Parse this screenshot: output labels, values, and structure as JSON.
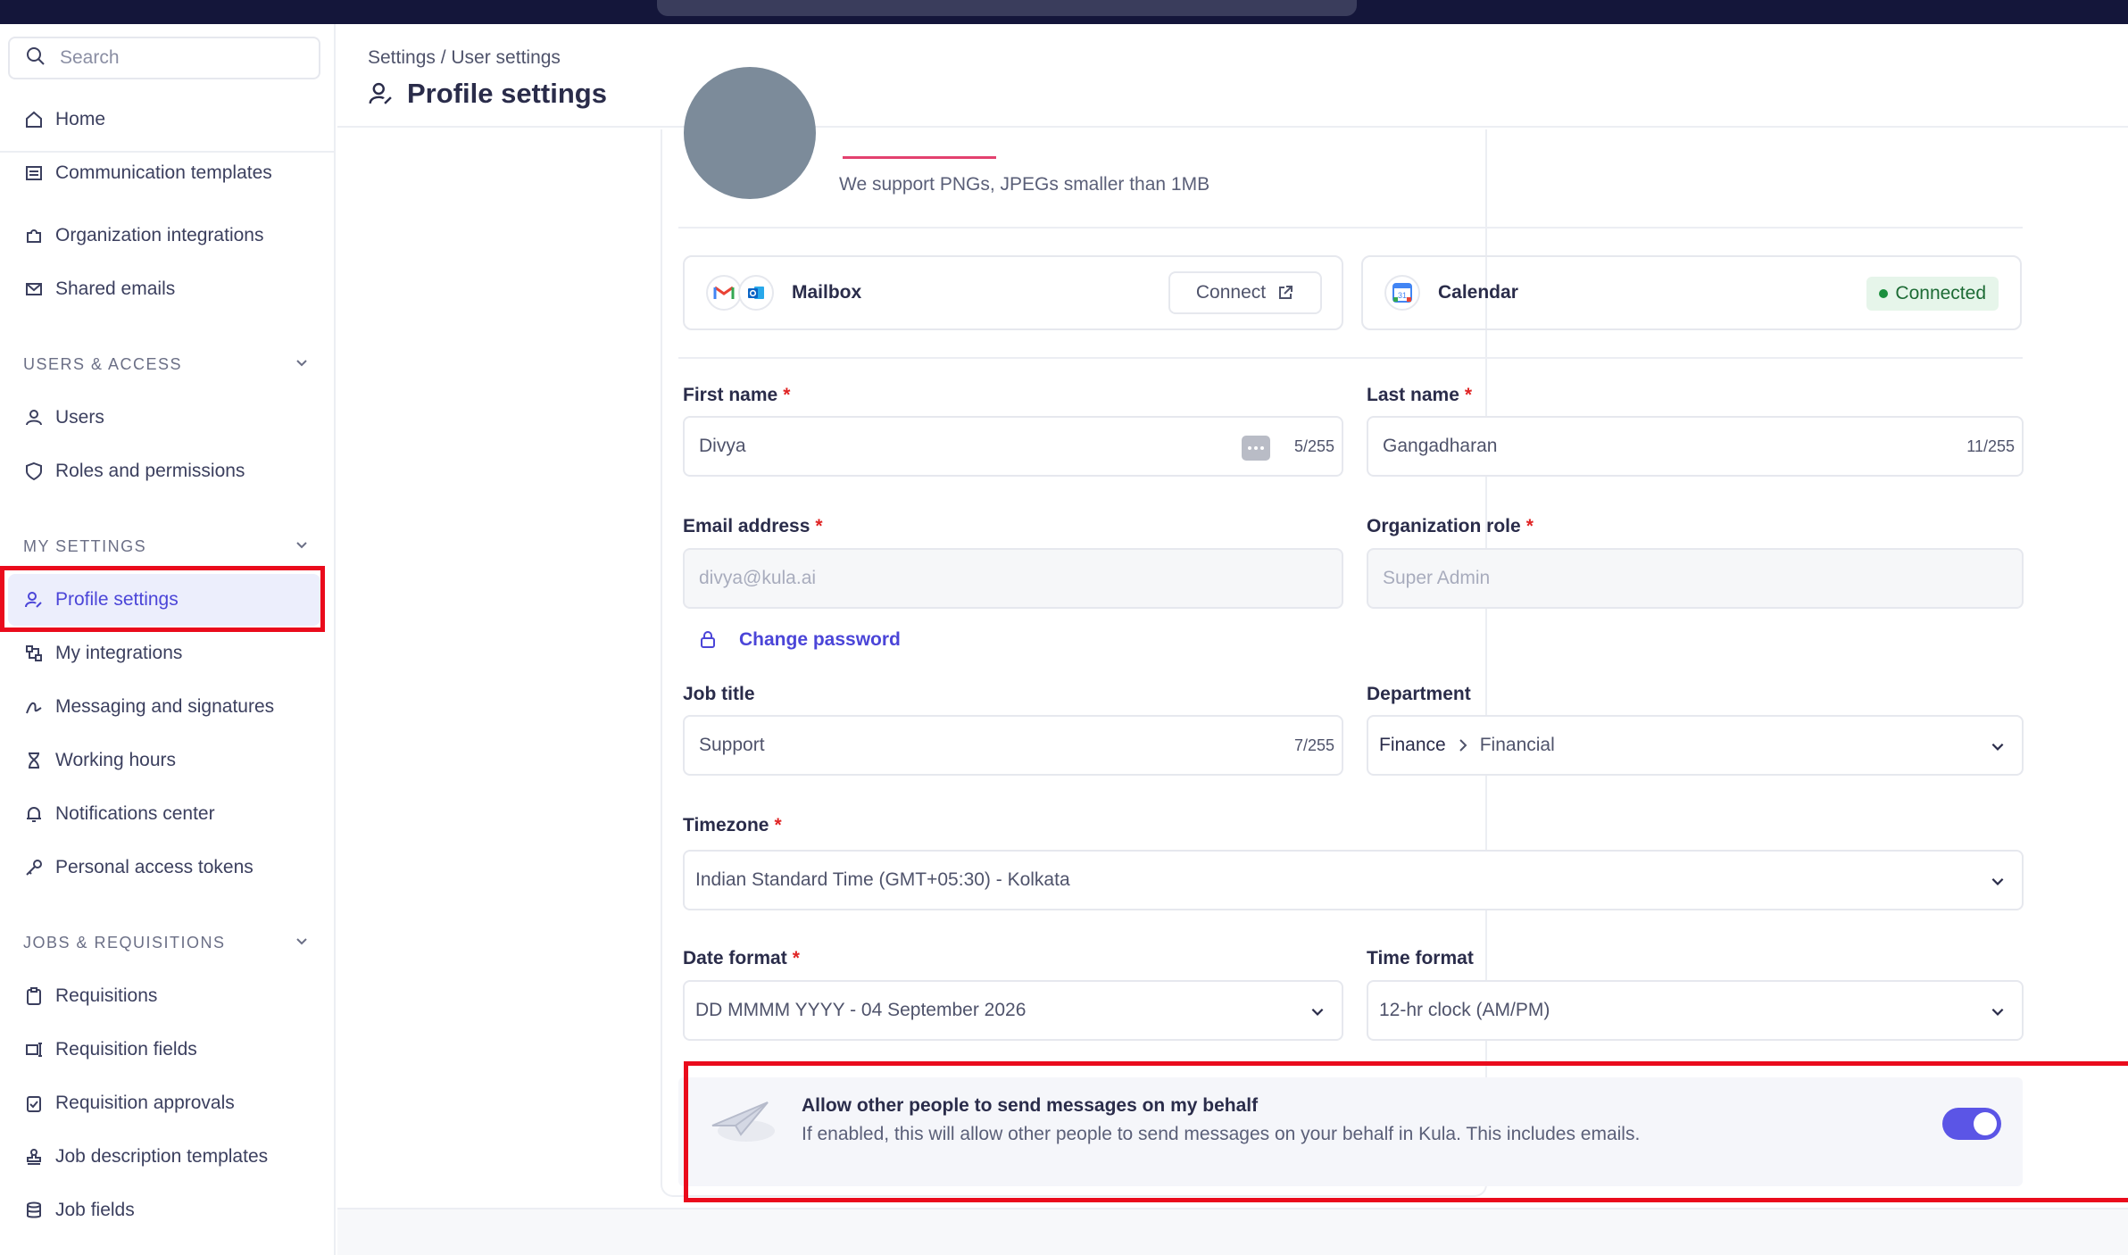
{
  "search": {
    "placeholder": "Search"
  },
  "sidebar": {
    "home": "Home",
    "settings_items": [
      "Communication templates",
      "Organization integrations",
      "Shared emails"
    ],
    "sections": {
      "users_access": "USERS & ACCESS",
      "my_settings": "MY SETTINGS",
      "jobs_requisitions": "JOBS & REQUISITIONS"
    },
    "users_items": [
      "Users",
      "Roles and permissions"
    ],
    "my_items": [
      "Profile settings",
      "My integrations",
      "Messaging and signatures",
      "Working hours",
      "Notifications center",
      "Personal access tokens"
    ],
    "jobs_items": [
      "Requisitions",
      "Requisition fields",
      "Requisition approvals",
      "Job description templates",
      "Job fields"
    ]
  },
  "header": {
    "breadcrumb": "Settings / User settings",
    "title": "Profile settings"
  },
  "avatar": {
    "note": "We support PNGs, JPEGs smaller than 1MB"
  },
  "integrations": {
    "mailbox": {
      "label": "Mailbox",
      "button": "Connect"
    },
    "calendar": {
      "label": "Calendar",
      "status": "Connected",
      "icon_text": "31"
    }
  },
  "form": {
    "first_name": {
      "label": "First name",
      "value": "Divya",
      "counter": "5/255"
    },
    "last_name": {
      "label": "Last name",
      "value": "Gangadharan",
      "counter": "11/255"
    },
    "email": {
      "label": "Email address",
      "value": "divya@kula.ai"
    },
    "org_role": {
      "label": "Organization role",
      "value": "Super Admin"
    },
    "change_password": "Change password",
    "job_title": {
      "label": "Job title",
      "value": "Support",
      "counter": "7/255"
    },
    "department": {
      "label": "Department",
      "value_parent": "Finance",
      "value_child": "Financial"
    },
    "timezone": {
      "label": "Timezone",
      "value": "Indian Standard Time (GMT+05:30) - Kolkata"
    },
    "date_format": {
      "label": "Date format",
      "value": "DD MMMM YYYY - 04 September 2026"
    },
    "time_format": {
      "label": "Time format",
      "value": "12-hr clock (AM/PM)"
    },
    "required_mark": "*"
  },
  "behalf": {
    "title": "Allow other people to send messages on my behalf",
    "description": "If enabled, this will allow other people to send messages on your behalf in Kula. This includes emails.",
    "enabled": true
  },
  "colors": {
    "accent": "#4b45d8",
    "highlight": "#ea0b1c",
    "connected": "#1a8f3d"
  }
}
